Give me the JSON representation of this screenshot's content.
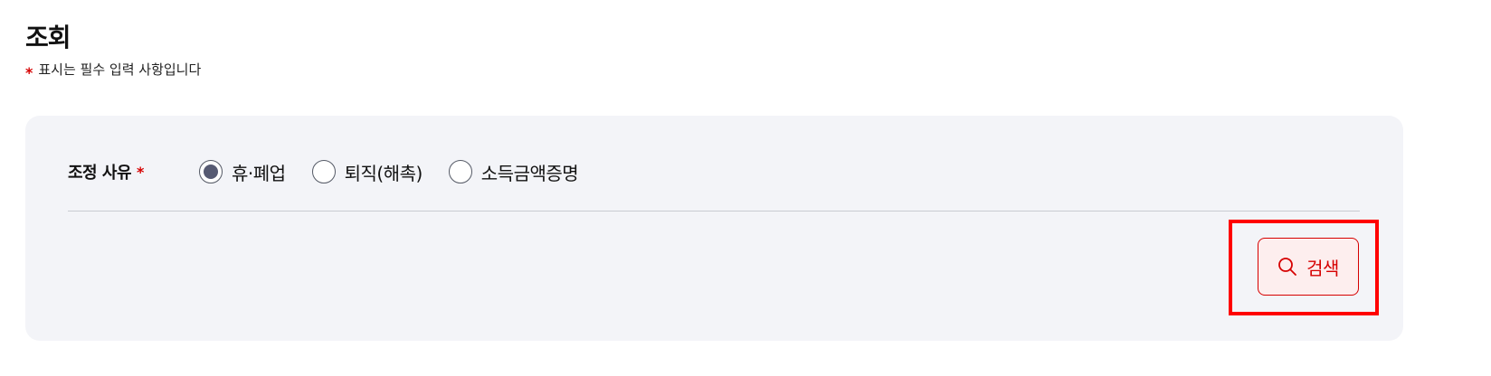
{
  "page": {
    "title": "조회",
    "required_note": {
      "asterisk": "*",
      "text": "표시는 필수 입력 사항입니다"
    }
  },
  "form": {
    "adjust_reason": {
      "label": "조정 사유",
      "required_mark": "*",
      "options": [
        {
          "label": "휴·폐업",
          "selected": true
        },
        {
          "label": "퇴직(해촉)",
          "selected": false
        },
        {
          "label": "소득금액증명",
          "selected": false
        }
      ]
    },
    "search_button": {
      "label": "검색",
      "icon": "search-icon"
    }
  },
  "colors": {
    "required": "#d60000",
    "panel_bg": "#f3f4f8",
    "radio_selected": "#565a72",
    "button_border": "#d60000",
    "button_bg": "#fdeeee",
    "highlight": "#ff0000"
  }
}
